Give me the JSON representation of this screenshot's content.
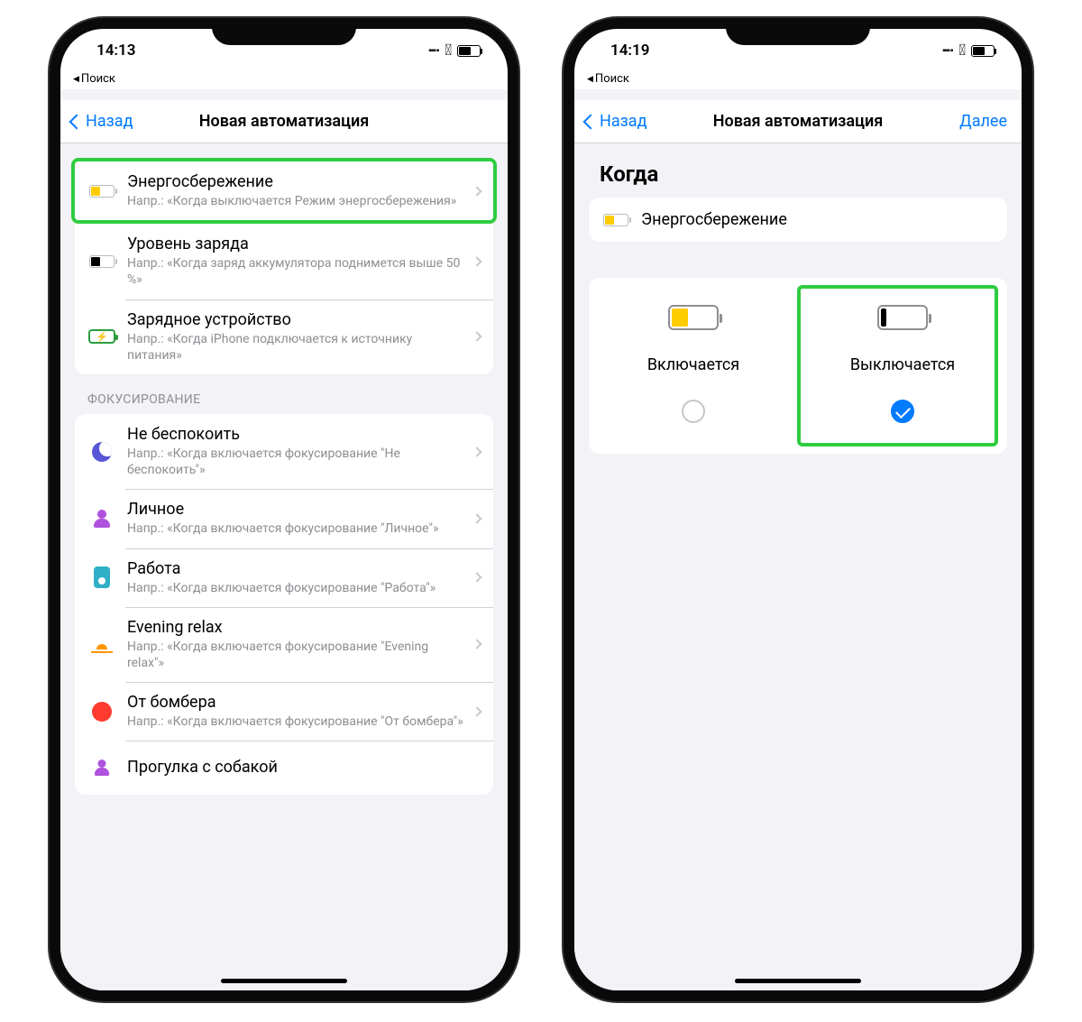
{
  "left": {
    "status_time": "14:13",
    "back_search": "Поиск",
    "header": {
      "back": "Назад",
      "title": "Новая автоматизация"
    },
    "battery_section": {
      "items": [
        {
          "title": "Энергосбережение",
          "sub": "Напр.: «Когда выключается Режим энергосбережения»"
        },
        {
          "title": "Уровень заряда",
          "sub": "Напр.: «Когда заряд аккумулятора поднимется выше 50 %»"
        },
        {
          "title": "Зарядное устройство",
          "sub": "Напр.: «Когда iPhone подключается к источнику питания»"
        }
      ]
    },
    "focus_header": "ФОКУСИРОВАНИЕ",
    "focus_items": [
      {
        "title": "Не беспокоить",
        "sub": "Напр.: «Когда включается фокусирование \"Не беспокоить\"»"
      },
      {
        "title": "Личное",
        "sub": "Напр.: «Когда включается фокусирование \"Личное\"»"
      },
      {
        "title": "Работа",
        "sub": "Напр.: «Когда включается фокусирование \"Работа\"»"
      },
      {
        "title": "Evening relax",
        "sub": "Напр.: «Когда включается фокусирование \"Evening relax\"»"
      },
      {
        "title": "От бомбера",
        "sub": "Напр.: «Когда включается фокусирование \"От бомбера\"»"
      },
      {
        "title": "Прогулка с собакой",
        "sub": ""
      }
    ]
  },
  "right": {
    "status_time": "14:19",
    "back_search": "Поиск",
    "header": {
      "back": "Назад",
      "title": "Новая автоматизация",
      "next": "Далее"
    },
    "when_title": "Когда",
    "trigger_label": "Энергосбережение",
    "choices": {
      "on": "Включается",
      "off": "Выключается"
    }
  }
}
